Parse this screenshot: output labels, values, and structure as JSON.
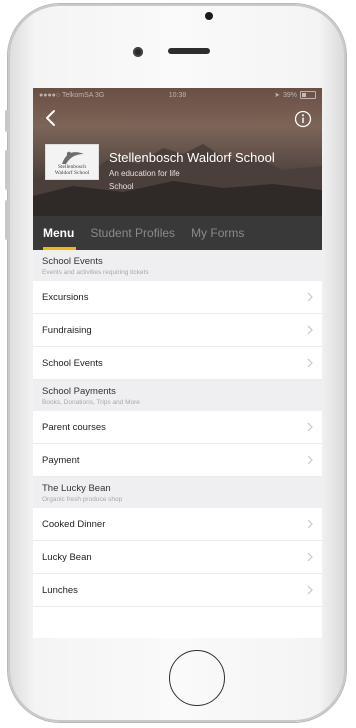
{
  "status_bar": {
    "carrier": "●●●●○ TelkomSA  3G",
    "time": "10:38",
    "battery": "39%"
  },
  "header": {
    "school_name": "Stellenbosch Waldorf School",
    "tagline": "An education for life",
    "type": "School",
    "logo_line1": "Stellenbosch",
    "logo_line2": "Waldorf School"
  },
  "tabs": [
    {
      "label": "Menu",
      "active": true
    },
    {
      "label": "Student Profiles",
      "active": false
    },
    {
      "label": "My Forms",
      "active": false
    }
  ],
  "sections": [
    {
      "title": "School Events",
      "subtitle": "Events and activities requiring tickets",
      "items": [
        "Excursions",
        "Fundraising",
        "School Events"
      ]
    },
    {
      "title": "School Payments",
      "subtitle": "Books, Donations, Trips and More",
      "items": [
        "Parent courses",
        "Payment"
      ]
    },
    {
      "title": "The Lucky Bean",
      "subtitle": "Organic fresh produce shop",
      "items": [
        "Cooked Dinner",
        "Lucky Bean",
        "Lunches"
      ]
    }
  ],
  "colors": {
    "tab_bar": "#393939",
    "active_indicator": "#f5b800",
    "section_bg": "#efeff2"
  },
  "icons": {
    "back": "chevron-left-icon",
    "info": "info-icon",
    "row": "chevron-right-icon"
  }
}
